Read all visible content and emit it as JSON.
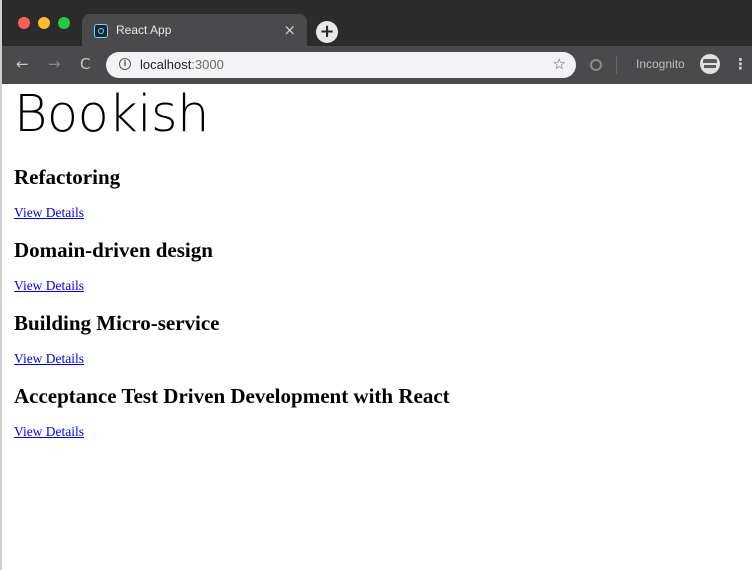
{
  "browser": {
    "tab_title": "React App",
    "tab_close_glyph": "×",
    "new_tab_glyph": "+",
    "url_host": "localhost",
    "url_port": ":3000",
    "incognito_label": "Incognito",
    "icons": {
      "back": "back-arrow-icon",
      "forward": "forward-arrow-icon",
      "reload": "reload-icon",
      "info": "info-icon",
      "star": "bookmark-star-icon",
      "menu": "menu-icon"
    }
  },
  "app": {
    "title": "Bookish",
    "books": [
      {
        "title": "Refactoring",
        "link_label": "View Details"
      },
      {
        "title": "Domain-driven design",
        "link_label": "View Details"
      },
      {
        "title": "Building Micro-service",
        "link_label": "View Details"
      },
      {
        "title": "Acceptance Test Driven Development with React",
        "link_label": "View Details"
      }
    ]
  },
  "colors": {
    "tabstrip": "#2b2b2c",
    "toolbar": "#4a4a4c",
    "link": "#0000ee"
  }
}
